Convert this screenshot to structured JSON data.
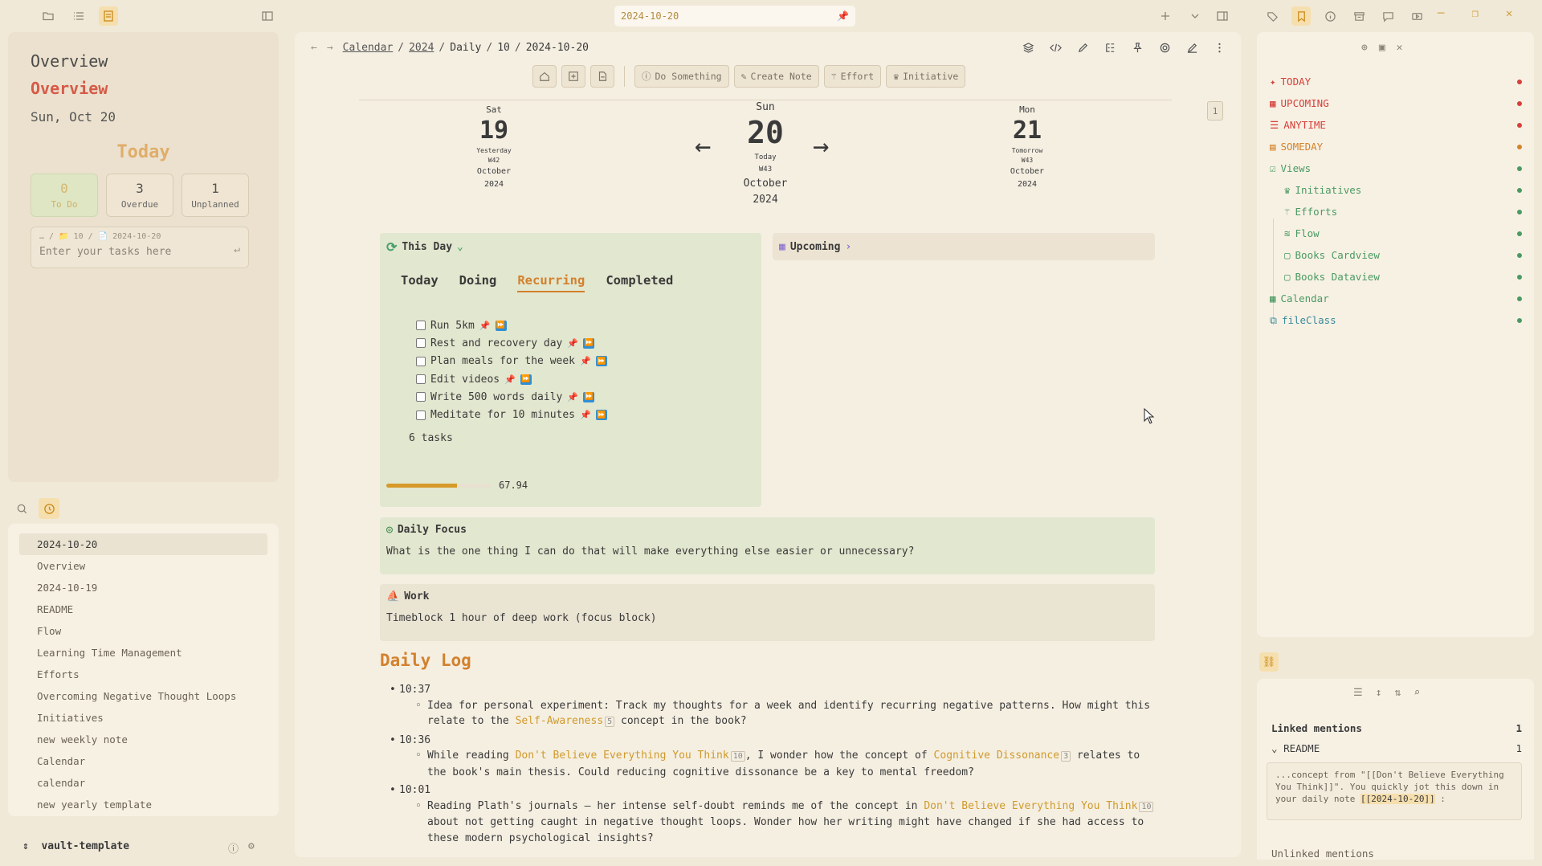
{
  "titlebar": {
    "tab_title": "2024-10-20"
  },
  "left": {
    "title": "Overview",
    "title_highlight": "Overview",
    "date": "Sun, Oct 20",
    "today_label": "Today",
    "stats": [
      {
        "num": "0",
        "label": "To Do"
      },
      {
        "num": "3",
        "label": "Overdue"
      },
      {
        "num": "1",
        "label": "Unplanned"
      }
    ],
    "task_path": "… / 📁 10 / 📄 2024-10-20",
    "task_placeholder": "Enter your tasks here",
    "recent_files": [
      "2024-10-20",
      "Overview",
      "2024-10-19",
      "README",
      "Flow",
      "Learning Time Management",
      "Efforts",
      "Overcoming Negative Thought Loops",
      "Initiatives",
      "new weekly note",
      "Calendar",
      "calendar",
      "new yearly template"
    ],
    "vault_name": "vault-template"
  },
  "main": {
    "breadcrumb": {
      "calendar": "Calendar",
      "year": "2024",
      "daily": "Daily",
      "month": "10",
      "current": "2024-10-20"
    },
    "actions": {
      "do_something": "Do Something",
      "create_note": "Create Note",
      "effort": "Effort",
      "initiative": "Initiative"
    },
    "page_badge": "1",
    "days": {
      "prev": {
        "dow": "Sat",
        "num": "19",
        "rel": "Yesterday",
        "week": "W42",
        "month": "October",
        "year": "2024"
      },
      "cur": {
        "dow": "Sun",
        "num": "20",
        "rel": "Today",
        "week": "W43",
        "month": "October",
        "year": "2024"
      },
      "next": {
        "dow": "Mon",
        "num": "21",
        "rel": "Tomorrow",
        "week": "W43",
        "month": "October",
        "year": "2024"
      }
    },
    "this_day": {
      "title": "This Day",
      "tabs": [
        "Today",
        "Doing",
        "Recurring",
        "Completed"
      ],
      "active_tab": "Recurring",
      "tasks": [
        "Run 5km",
        "Rest and recovery day",
        "Plan meals for the week",
        "Edit videos",
        "Write 500 words daily",
        "Meditate for 10 minutes"
      ],
      "count": "6 tasks",
      "progress": 67.94,
      "progress_label": "67.94"
    },
    "upcoming": "Upcoming",
    "focus": {
      "title": "Daily Focus",
      "text": "What is the one thing I can do that will make everything else easier or unnecessary?"
    },
    "work": {
      "title": "Work",
      "text": "Timeblock 1 hour of deep work (focus block)"
    },
    "daily_log": {
      "heading": "Daily Log",
      "entries": [
        {
          "time": "10:37",
          "pre": "Idea for personal experiment: Track my thoughts for a week and identify recurring negative patterns. How might this relate to the ",
          "link": "Self-Awareness",
          "count": "5",
          "post": " concept in the book?"
        },
        {
          "time": "10:36",
          "pre": "While reading ",
          "link": "Don't Believe Everything You Think",
          "count": "10",
          "mid": ", I wonder how the concept of ",
          "link2": "Cognitive Dissonance",
          "count2": "3",
          "post": " relates to the book's main thesis. Could reducing cognitive dissonance be a key to mental freedom?"
        },
        {
          "time": "10:01",
          "pre": "Reading Plath's journals – her intense self-doubt reminds me of the concept in ",
          "link": "Don't Believe Everything You Think",
          "count": "10",
          "post": " about not getting caught in negative thought loops. Wonder how her writing might have changed if she had access to these modern psychological insights?"
        }
      ]
    }
  },
  "right": {
    "items": [
      {
        "label": "TODAY",
        "color": "#d6403a"
      },
      {
        "label": "UPCOMING",
        "color": "#d6403a"
      },
      {
        "label": "ANYTIME",
        "color": "#d6403a"
      },
      {
        "label": "SOMEDAY",
        "color": "#d4832a"
      },
      {
        "label": "Views",
        "color": "#4a9a62"
      },
      {
        "label": "Initiatives",
        "color": "#4a9a62"
      },
      {
        "label": "Efforts",
        "color": "#4a9a62"
      },
      {
        "label": "Flow",
        "color": "#4a9a62"
      },
      {
        "label": "Books Cardview",
        "color": "#4a9a62"
      },
      {
        "label": "Books Dataview",
        "color": "#4a9a62"
      },
      {
        "label": "Calendar",
        "color": "#4a9a62"
      },
      {
        "label": "fileClass",
        "color": "#3a8a9a"
      }
    ],
    "linked_mentions": "Linked mentions",
    "linked_count": "1",
    "readme": "README",
    "readme_count": "1",
    "snippet_pre": "...concept from \"[[Don't Believe Everything You Think]]\". You quickly jot this down in your daily note ",
    "snippet_link": "[[2024-10-20]]",
    "snippet_post": " :",
    "unlinked_mentions": "Unlinked mentions"
  }
}
